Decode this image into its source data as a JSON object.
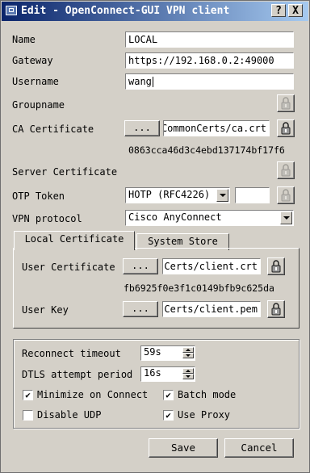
{
  "window": {
    "title": "Edit - OpenConnect-GUI VPN client",
    "help_glyph": "?",
    "close_glyph": "X"
  },
  "form": {
    "name": {
      "label": "Name",
      "value": "LOCAL"
    },
    "gateway": {
      "label": "Gateway",
      "value": "https://192.168.0.2:49000"
    },
    "username": {
      "label": "Username",
      "value": "wang"
    },
    "groupname": {
      "label": "Groupname"
    },
    "ca_certificate": {
      "label": "CA Certificate",
      "browse": "...",
      "value": "CommonCerts/ca.crt",
      "hash": "0863cca46d3c4ebd137174bf17f6"
    },
    "server_certificate": {
      "label": "Server Certificate"
    },
    "otp_token": {
      "label": "OTP Token",
      "selected": "HOTP (RFC4226)",
      "value": ""
    },
    "vpn_protocol": {
      "label": "VPN protocol",
      "selected": "Cisco AnyConnect"
    }
  },
  "tabs": [
    {
      "label": "Local Certificate",
      "active": true
    },
    {
      "label": "System Store",
      "active": false
    }
  ],
  "local_cert": {
    "user_certificate": {
      "label": "User Certificate",
      "browse": "...",
      "value": "Certs/client.crt",
      "hash": "fb6925f0e3f1c0149bfb9c625da"
    },
    "user_key": {
      "label": "User Key",
      "browse": "...",
      "value": "Certs/client.pem"
    }
  },
  "options": {
    "reconnect_timeout": {
      "label": "Reconnect timeout",
      "value": "59s"
    },
    "dtls_attempt_period": {
      "label": "DTLS attempt period",
      "value": "16s"
    },
    "minimize_on_connect": {
      "label": "Minimize on Connect",
      "checked": true
    },
    "batch_mode": {
      "label": "Batch mode",
      "checked": true
    },
    "disable_udp": {
      "label": "Disable UDP",
      "checked": false
    },
    "use_proxy": {
      "label": "Use Proxy",
      "checked": true
    }
  },
  "check_glyph": "✔",
  "buttons": {
    "save": "Save",
    "cancel": "Cancel"
  },
  "icons": {
    "app": "app-window-icon",
    "key": "key-clear-icon"
  },
  "colors": {
    "title_start": "#0a246a",
    "title_end": "#a6caf0",
    "face": "#d4d0c8"
  }
}
